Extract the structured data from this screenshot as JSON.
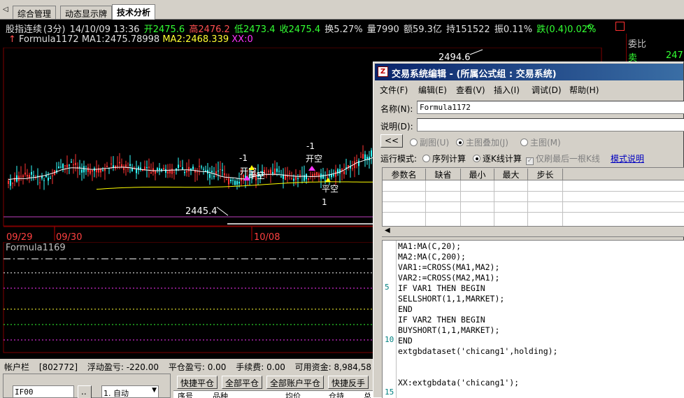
{
  "tabs": {
    "arrow": "◁",
    "items": [
      {
        "label": "综合管理"
      },
      {
        "label": "动态显示牌"
      },
      {
        "label": "技术分析"
      }
    ]
  },
  "header": {
    "name": "股指连续",
    "period": "(3分)",
    "datetime": "14/10/09 13:36",
    "open": "开2475.6",
    "high": "高2476.2",
    "low": "低2473.4",
    "close": "收2475.4",
    "turnover": "换5.27%",
    "volume": "量7990",
    "amount": "额59.3亿",
    "position": "持151522",
    "amplitude": "振0.11%",
    "change": "跌(0.4)0.02%"
  },
  "formula_line": {
    "name": "Formula1172",
    "ma1": "MA1:2475.78998",
    "ma2": "MA2:2468.339",
    "xx": "XX:0"
  },
  "chart": {
    "high_label": "2494.6",
    "low_label": "2445.4",
    "dates": [
      "09/29",
      "09/30",
      "10/08"
    ],
    "signals": [
      {
        "num": "-1",
        "text": "开空"
      },
      {
        "num": "-1",
        "text": "开空"
      },
      {
        "num": "1",
        "text": "平空"
      },
      {
        "num": "1",
        "text": "平空"
      }
    ],
    "sub_label": "Formula1169",
    "colors": {
      "up": "#ff3333",
      "down": "#33ffff",
      "ma1": "#ffffff",
      "ma2": "#ffff00"
    }
  },
  "right_panel": {
    "title": "委比",
    "sell_label": "卖",
    "sell_value": "247"
  },
  "account": {
    "bar_label": "帐户栏",
    "account_id": "[802772]",
    "float_pl": "浮动盈亏: -220.00",
    "close_pl": "平仓盈亏: 0.00",
    "fee": "手续费: 0.00",
    "available": "可用资金: 8,984,58",
    "contract": "IF00",
    "more_btn": "..",
    "mode": "1. 自动",
    "buttons": [
      "快捷平仓",
      "全部平仓",
      "全部账户平仓",
      "快捷反手"
    ],
    "table_headers": [
      "序号",
      "品种",
      "均价",
      "仓持",
      "总"
    ]
  },
  "dialog": {
    "title": "交易系统编辑 - (所属公式组 : 交易系统)",
    "menu": [
      "文件(F)",
      "编辑(E)",
      "查看(V)",
      "插入(I)",
      "调试(D)",
      "帮助(H)"
    ],
    "name_label": "名称(N):",
    "name_value": "Formula1172",
    "desc_label": "说明(D):",
    "desc_value": "",
    "collapse_btn": "<<",
    "display_options": [
      "副图(U)",
      "主图叠加(J)",
      "主图(M)"
    ],
    "run_mode_label": "运行模式:",
    "run_modes": [
      "序列计算",
      "逐K线计算"
    ],
    "last_bar_only": "仅刷最后一根K线",
    "mode_help": "模式说明",
    "param_headers": [
      "参数名",
      "缺省",
      "最小",
      "最大",
      "步长"
    ],
    "line_numbers": [
      "5",
      "10",
      "15"
    ],
    "code": [
      "MA1:MA(C,20);",
      "MA2:MA(C,200);",
      "VAR1:=CROSS(MA1,MA2);",
      "VAR2:=CROSS(MA2,MA1);",
      "IF VAR1 THEN BEGIN",
      "SELLSHORT(1,1,MARKET);",
      "END",
      "IF VAR2 THEN BEGIN",
      "BUYSHORT(1,1,MARKET);",
      "END",
      "extgbdataset('chicang1',holding);",
      "",
      "",
      "XX:extgbdata('chicang1');"
    ]
  }
}
